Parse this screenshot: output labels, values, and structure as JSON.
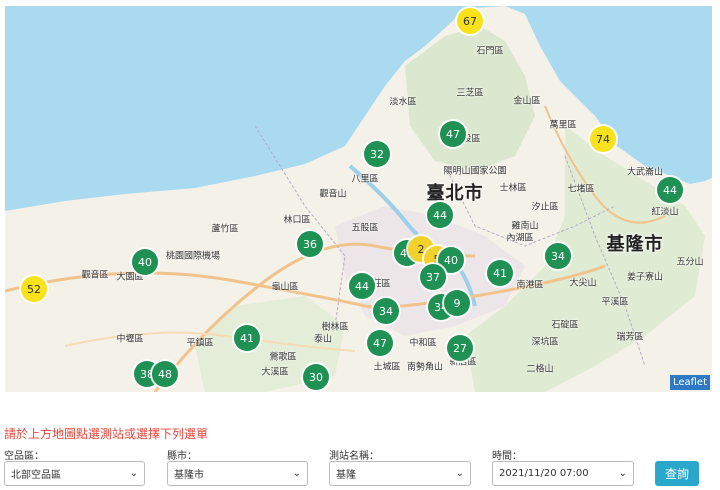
{
  "map": {
    "cities": [
      {
        "name": "臺北市"
      },
      {
        "name": "基隆市"
      }
    ],
    "districts": [
      "石門區",
      "三芝區",
      "淡水區",
      "金山區",
      "萬里區",
      "北投區",
      "陽明山國家公園",
      "士林區",
      "汐止區",
      "七堵區",
      "八里區",
      "觀音山",
      "五股區",
      "林口區",
      "蘆竹區",
      "大園區",
      "觀音區",
      "桃園國際機場",
      "內湖區",
      "南港區",
      "龜山區",
      "新莊區",
      "大溪區",
      "平溪區",
      "中壢區",
      "平鎮區",
      "中和區",
      "土城區",
      "新店區",
      "石碇區",
      "深坑區",
      "南勢角山",
      "鶯歌區",
      "樹林區",
      "瑞芳區",
      "大武崙山",
      "紅淡山",
      "五分山",
      "姜子寮山",
      "大尖山",
      "二格山",
      "雞南山",
      "泰山"
    ],
    "markers": [
      {
        "value": "67",
        "color": "yellow"
      },
      {
        "value": "47",
        "color": "green"
      },
      {
        "value": "74",
        "color": "yellow"
      },
      {
        "value": "32",
        "color": "green"
      },
      {
        "value": "44",
        "color": "green"
      },
      {
        "value": "44",
        "color": "green"
      },
      {
        "value": "36",
        "color": "green"
      },
      {
        "value": "40",
        "color": "green"
      },
      {
        "value": "52",
        "color": "yellow"
      },
      {
        "value": "45",
        "color": "green"
      },
      {
        "value": "2",
        "color": "yellow"
      },
      {
        "value": "5",
        "color": "yellow"
      },
      {
        "value": "40",
        "color": "green"
      },
      {
        "value": "37",
        "color": "green"
      },
      {
        "value": "41",
        "color": "green"
      },
      {
        "value": "34",
        "color": "green"
      },
      {
        "value": "44",
        "color": "green"
      },
      {
        "value": "34",
        "color": "green"
      },
      {
        "value": "34",
        "color": "green"
      },
      {
        "value": "9",
        "color": "green"
      },
      {
        "value": "41",
        "color": "green"
      },
      {
        "value": "47",
        "color": "green"
      },
      {
        "value": "27",
        "color": "green"
      },
      {
        "value": "38",
        "color": "green"
      },
      {
        "value": "48",
        "color": "green"
      },
      {
        "value": "30",
        "color": "green"
      }
    ],
    "attribution": "Leaflet"
  },
  "form": {
    "instruction": "請於上方地圖點選測站或選擇下列選單",
    "air_region_label": "空品區：",
    "air_region_value": "北部空品區",
    "county_label": "縣市：",
    "county_value": "基隆市",
    "station_label": "測站名稱：",
    "station_value": "基隆",
    "time_label": "時間：",
    "time_value": "2021/11/20 07:00",
    "query_button": "查詢"
  },
  "colors": {
    "good": "#1f9155",
    "moderate": "#f7e21b",
    "sea": "#aadaf0",
    "instruction": "#e8453c",
    "button": "#29a8cc"
  }
}
